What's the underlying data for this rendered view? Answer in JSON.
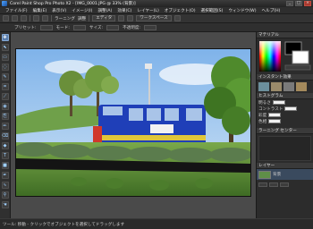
{
  "window": {
    "title": "Corel Paint Shop Pro Photo X2 - [IMG_0001.JPG @ 33% (背景)]",
    "min_glyph": "_",
    "max_glyph": "□",
    "close_glyph": "×"
  },
  "menu": {
    "items": [
      "ファイル(F)",
      "編集(E)",
      "表示(V)",
      "イメージ(I)",
      "調整(A)",
      "効果(C)",
      "レイヤー(L)",
      "オブジェクト(O)",
      "選択範囲(S)",
      "ウィンドウ(W)",
      "ヘルプ(H)"
    ]
  },
  "toolbar": {
    "learn_label": "ラーニング",
    "adjust_label": "調整",
    "mode_label": "エディタ",
    "workspace_label": "ワークスペース"
  },
  "options": {
    "label_1": "プリセット:",
    "label_2": "モード:",
    "label_3": "サイズ:",
    "label_4": "不透明度:"
  },
  "palettes": {
    "materials_title": "マテリアル",
    "instant_title": "インスタント効果",
    "histogram_title": "ヒストグラム",
    "learning_title": "ラーニング センター",
    "layers_title": "レイヤー",
    "layer_name": "背景",
    "row_labels": [
      "明るさ",
      "コントラスト",
      "彩度",
      "色相"
    ]
  },
  "colors": {
    "window_bg": "#2b2b2b",
    "workspace_bg": "#4a4a4a",
    "accent": "#5b7fae",
    "bus_blue": "#1f3fb8",
    "sky": "#9ec7f0"
  },
  "status": {
    "text": "ツール: 移動 - クリックでオブジェクトを選択してドラッグします"
  }
}
